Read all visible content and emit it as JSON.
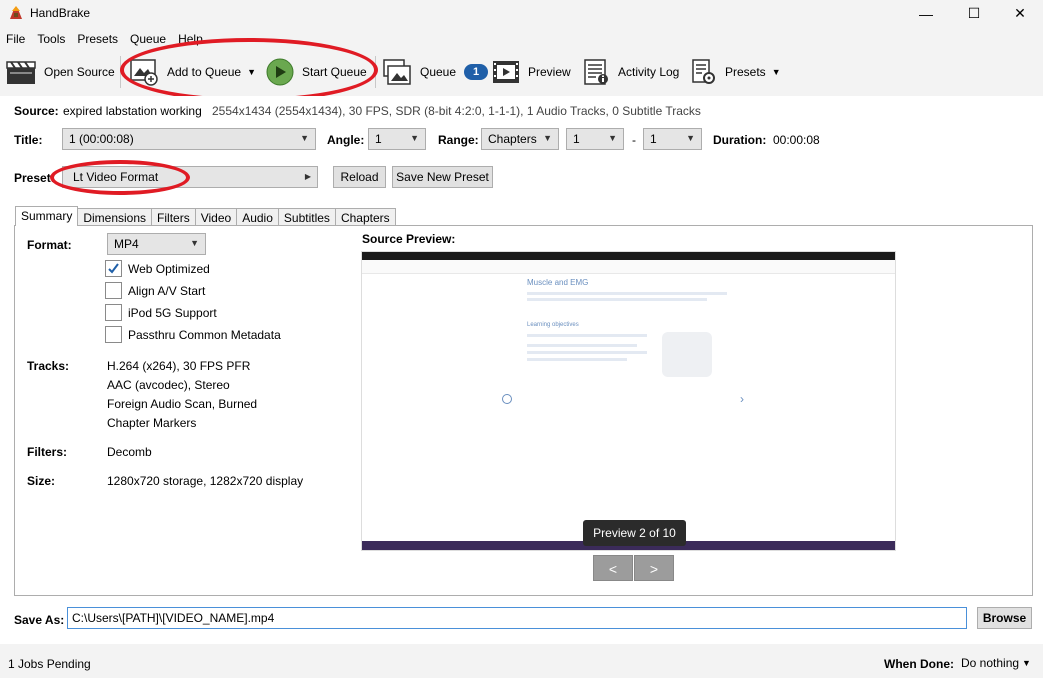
{
  "window": {
    "title": "HandBrake",
    "minimize": "—",
    "maximize": "☐",
    "close": "✕"
  },
  "menu": [
    "File",
    "Tools",
    "Presets",
    "Queue",
    "Help"
  ],
  "toolbar": {
    "open_source": "Open Source",
    "add_to_queue": "Add to Queue",
    "start_queue": "Start Queue",
    "queue": "Queue",
    "queue_count": "1",
    "preview": "Preview",
    "activity_log": "Activity Log",
    "presets": "Presets"
  },
  "source": {
    "label": "Source:",
    "name": "expired labstation working",
    "details": "2554x1434 (2554x1434), 30 FPS, SDR (8-bit 4:2:0, 1-1-1), 1 Audio Tracks, 0 Subtitle Tracks"
  },
  "title_row": {
    "title_label": "Title:",
    "title_value": "1  (00:00:08)",
    "angle_label": "Angle:",
    "angle_value": "1",
    "range_label": "Range:",
    "range_type": "Chapters",
    "range_start": "1",
    "range_dash": "-",
    "range_end": "1",
    "duration_label": "Duration:",
    "duration_value": "00:00:08"
  },
  "preset": {
    "label": "Preset:",
    "value": "Lt Video Format",
    "reload": "Reload",
    "save_new": "Save New Preset"
  },
  "tabs": [
    "Summary",
    "Dimensions",
    "Filters",
    "Video",
    "Audio",
    "Subtitles",
    "Chapters"
  ],
  "summary": {
    "format_label": "Format:",
    "format_value": "MP4",
    "options": [
      {
        "label": "Web Optimized",
        "checked": true
      },
      {
        "label": "Align A/V Start",
        "checked": false
      },
      {
        "label": "iPod 5G Support",
        "checked": false
      },
      {
        "label": "Passthru Common Metadata",
        "checked": false
      }
    ],
    "tracks_label": "Tracks:",
    "tracks": [
      "H.264 (x264), 30 FPS PFR",
      "AAC (avcodec), Stereo",
      "Foreign Audio Scan, Burned",
      "Chapter Markers"
    ],
    "filters_label": "Filters:",
    "filters_value": "Decomb",
    "size_label": "Size:",
    "size_value": "1280x720 storage, 1282x720 display"
  },
  "preview": {
    "label": "Source Preview:",
    "counter": "Preview 2 of 10",
    "prev": "<",
    "next": ">",
    "slide_heading": "Muscle and EMG",
    "slide_subheading": "Learning objectives"
  },
  "save_as": {
    "label": "Save As:",
    "path": "C:\\Users\\[PATH]\\[VIDEO_NAME].mp4",
    "browse": "Browse"
  },
  "status": {
    "jobs": "1 Jobs Pending",
    "when_done_label": "When Done:",
    "when_done_value": "Do nothing"
  }
}
